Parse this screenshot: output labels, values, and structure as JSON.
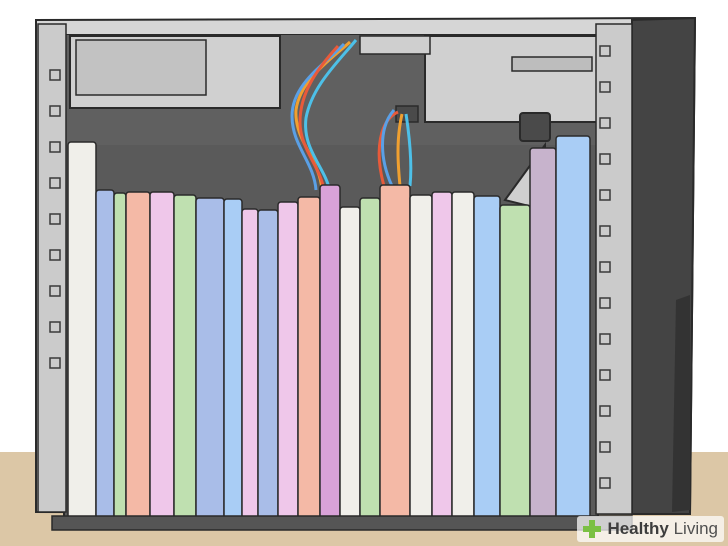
{
  "scene": {
    "subject": "desktop-pc-case-filled-with-books",
    "colors": {
      "background": "#ffffff",
      "table": "#dcc7a6",
      "case_frame": "#d6d6d6",
      "case_interior": "#5a5a5a",
      "side_panel": "#444444",
      "books": [
        "#f0efea",
        "#a9bde8",
        "#bfe0b0",
        "#f4b9a6",
        "#efc7ea",
        "#bfe0b0",
        "#a9bde8",
        "#a9cdf5",
        "#efc7ea",
        "#a9bde8",
        "#efc7ea",
        "#f4b9a6",
        "#d9a2d8",
        "#f0efea",
        "#bfe0b0",
        "#f4b9a6",
        "#f0efea",
        "#efc7ea",
        "#f0efea",
        "#a9cdf5",
        "#bfe0b0",
        "#c7b3cc",
        "#a9cdf5"
      ],
      "wires": [
        "#f0a030",
        "#5aa0e6",
        "#e85a3a",
        "#4dc0e8"
      ]
    }
  },
  "watermark": {
    "brand_bold": "Healthy",
    "brand_light": " Living",
    "icon": "plus-cross-icon",
    "accent": "#7bc043"
  }
}
